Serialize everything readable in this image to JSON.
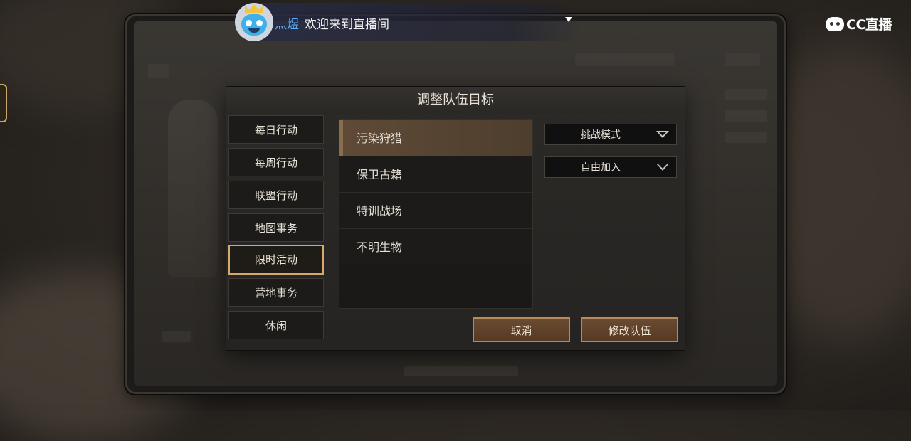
{
  "stream": {
    "username": "灬煜",
    "welcome": "欢迎来到直播间",
    "logo_text": "CC直播"
  },
  "dialog": {
    "title": "调整队伍目标",
    "categories": [
      "每日行动",
      "每周行动",
      "联盟行动",
      "地图事务",
      "限时活动",
      "营地事务",
      "休闲"
    ],
    "active_category": "限时活动",
    "activities": [
      "污染狩猎",
      "保卫古籍",
      "特训战场",
      "不明生物"
    ],
    "active_activity": "污染狩猎",
    "mode_dropdown": "挑战模式",
    "join_dropdown": "自由加入",
    "cancel_label": "取消",
    "confirm_label": "修改队伍"
  },
  "colors": {
    "accent_border": "#d6a96c",
    "button_fill": "#5f4129",
    "selected_row": "#5a4733",
    "username": "#5ab0ff"
  },
  "icons": [
    "avatar-crown-icon",
    "dropdown-caret-icon",
    "cc-live-logo-icon",
    "triangle-down-icon"
  ]
}
